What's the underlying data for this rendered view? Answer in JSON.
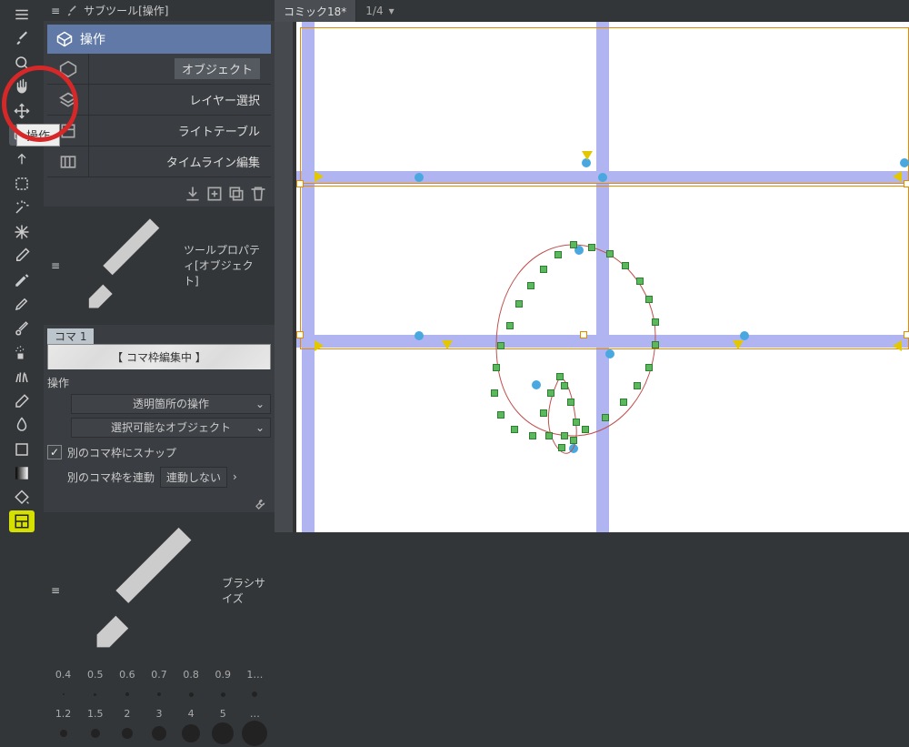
{
  "subtool_panel_title": "サブツール[操作]",
  "subtool_main": "操作",
  "subtool_items": [
    {
      "label": "オブジェクト",
      "active": true
    },
    {
      "label": "レイヤー選択",
      "active": false
    },
    {
      "label": "ライトテーブル",
      "active": false
    },
    {
      "label": "タイムライン編集",
      "active": false
    }
  ],
  "tooltip": "操作",
  "toolprop_title": "ツールプロパティ[オブジェクト]",
  "koma_tag": "コマ 1",
  "editing_banner": "【 コマ枠編集中 】",
  "prop_section": "操作",
  "dropdown_transparent": "透明箇所の操作",
  "dropdown_selectable": "選択可能なオブジェクト",
  "checkbox_snap": "別のコマ枠にスナップ",
  "link_label": "別のコマ枠を連動",
  "link_value": "連動しない",
  "brush_header": "ブラシサイズ",
  "brush_row1": [
    "0.4",
    "0.5",
    "0.6",
    "0.7",
    "0.8",
    "0.9",
    "1…"
  ],
  "brush_row2": [
    "1.2",
    "1.5",
    "2",
    "3",
    "4",
    "5",
    "…"
  ],
  "brush_dot_sizes_row1": [
    2,
    3,
    4,
    4,
    5,
    5,
    6
  ],
  "brush_dot_sizes_row2": [
    8,
    10,
    12,
    16,
    20,
    24,
    28
  ],
  "tab_label": "コミック18*",
  "page_indicator": "1/4",
  "tools_left": [
    "menu",
    "brush",
    "magnifier",
    "hand",
    "move",
    "operation-cube",
    "arrow",
    "lasso",
    "magic-wand",
    "burst",
    "eyedropper",
    "pen",
    "marker",
    "brush2",
    "spray",
    "grass",
    "eraser",
    "blur",
    "square",
    "gradient",
    "bucket",
    "frame"
  ],
  "colors": {
    "accent_blue": "#6179a6",
    "guide_purple": "#b0b4f0"
  }
}
